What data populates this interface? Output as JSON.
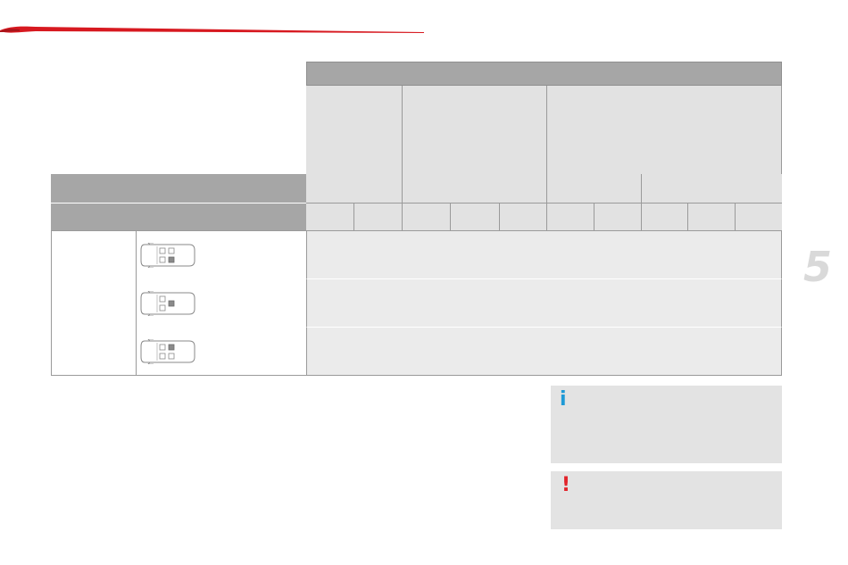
{
  "page": {
    "chapter_number": "5"
  },
  "notices": {
    "info_icon": "i",
    "warning_icon": "!"
  },
  "colors": {
    "accent_red": "#d71920",
    "info_blue": "#1e9ad6",
    "warning_red": "#e2232a",
    "table_header_dark": "#a6a6a6",
    "table_header_light": "#e2e2e2",
    "table_row_light": "#ebebeb"
  },
  "icons": {
    "seat_rows": [
      "van-seat-right-icon",
      "van-seat-centre-icon",
      "van-seat-left-icon"
    ],
    "notices": [
      "info-icon",
      "warning-icon"
    ]
  }
}
